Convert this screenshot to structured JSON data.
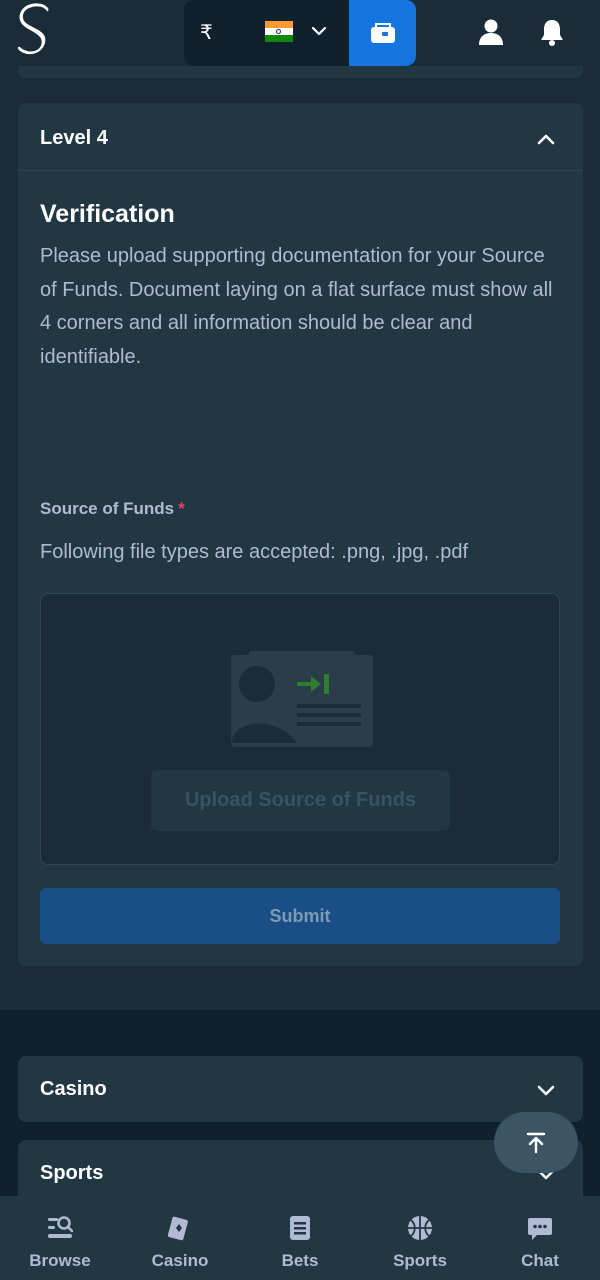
{
  "header": {
    "logo_icon": "stake-s-logo",
    "currency_symbol": "₹",
    "flag_icon": "india-flag-icon",
    "wallet_icon": "wallet-icon",
    "user_icon": "user-icon",
    "bell_icon": "bell-icon",
    "colors": {
      "background": "#1a2c38",
      "wallet_button": "#1475e1"
    }
  },
  "level_panel": {
    "title": "Level 4",
    "verification_title": "Verification",
    "verification_text": "Please upload supporting documentation for your Source of Funds. Document laying on a flat surface must show all 4 corners and all information should be clear and identifiable.",
    "source_label": "Source of Funds",
    "required_marker": "*",
    "file_types_text": "Following file types are accepted: .png, .jpg, .pdf",
    "upload_button_label": "Upload Source of Funds",
    "submit_label": "Submit"
  },
  "accordions": [
    {
      "label": "Casino"
    },
    {
      "label": "Sports"
    }
  ],
  "bottom_nav": [
    {
      "label": "Browse",
      "icon": "browse-icon"
    },
    {
      "label": "Casino",
      "icon": "casino-icon"
    },
    {
      "label": "Bets",
      "icon": "bets-icon"
    },
    {
      "label": "Sports",
      "icon": "sports-icon"
    },
    {
      "label": "Chat",
      "icon": "chat-icon"
    }
  ]
}
